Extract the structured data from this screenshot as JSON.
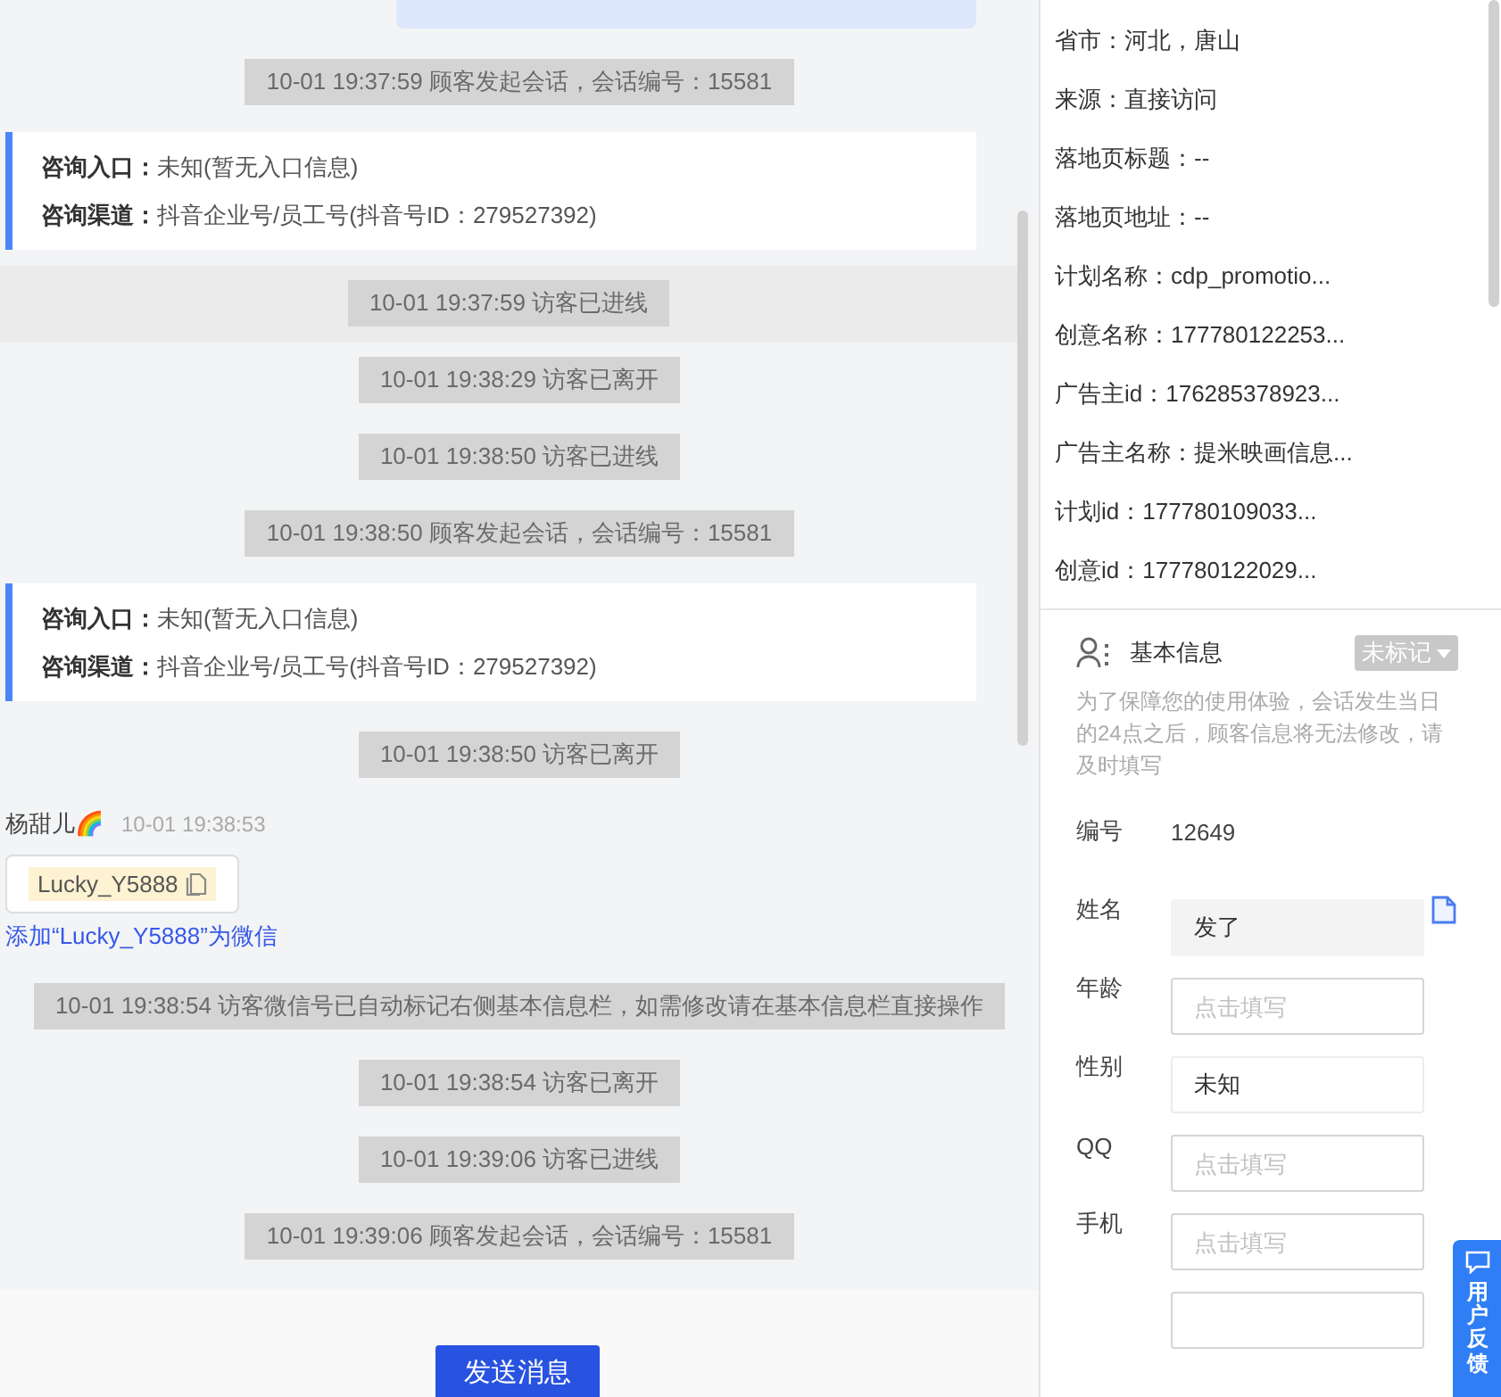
{
  "chat": {
    "events": [
      {
        "kind": "system",
        "text": "10-01 19:37:59 顾客发起会话，会话编号：15581",
        "highlighted": false
      },
      {
        "kind": "source",
        "rows": [
          {
            "label": "咨询入口：",
            "value": "未知(暂无入口信息)"
          },
          {
            "label": "咨询渠道：",
            "value": "抖音企业号/员工号(抖音号ID：279527392)"
          }
        ]
      },
      {
        "kind": "system",
        "text": "10-01 19:37:59 访客已进线",
        "highlighted": true
      },
      {
        "kind": "system",
        "text": "10-01 19:38:29 访客已离开",
        "highlighted": false
      },
      {
        "kind": "system",
        "text": "10-01 19:38:50 访客已进线",
        "highlighted": false
      },
      {
        "kind": "system",
        "text": "10-01 19:38:50 顾客发起会话，会话编号：15581",
        "highlighted": false
      },
      {
        "kind": "source",
        "rows": [
          {
            "label": "咨询入口：",
            "value": "未知(暂无入口信息)"
          },
          {
            "label": "咨询渠道：",
            "value": "抖音企业号/员工号(抖音号ID：279527392)"
          }
        ]
      },
      {
        "kind": "system",
        "text": "10-01 19:38:50 访客已离开",
        "highlighted": false
      },
      {
        "kind": "visitor",
        "name": "杨甜儿🌈",
        "time": "10-01 19:38:53",
        "wechat": "Lucky_Y5888",
        "link": "添加“Lucky_Y5888”为微信"
      },
      {
        "kind": "system",
        "text": "10-01 19:38:54 访客微信号已自动标记右侧基本信息栏，如需修改请在基本信息栏直接操作",
        "highlighted": false
      },
      {
        "kind": "system",
        "text": "10-01 19:38:54 访客已离开",
        "highlighted": false
      },
      {
        "kind": "system",
        "text": "10-01 19:39:06 访客已进线",
        "highlighted": false
      },
      {
        "kind": "system",
        "text": "10-01 19:39:06 顾客发起会话，会话编号：15581",
        "highlighted": false
      }
    ],
    "send_button": "发送消息"
  },
  "visit_info": [
    "省市：河北，唐山",
    "来源：直接访问",
    "落地页标题：--",
    "落地页地址：--",
    "计划名称：cdp_promotio...",
    "创意名称：177780122253...",
    "广告主id：176285378923...",
    "广告主名称：提米映画信息...",
    "计划id：177780109033...",
    "创意id：177780122029..."
  ],
  "basic_info": {
    "title": "基本信息",
    "tag": "未标记",
    "note": "为了保障您的使用体验，会话发生当日的24点之后，顾客信息将无法修改，请及时填写",
    "fields": [
      {
        "kind": "text",
        "label": "编号",
        "value": "12649"
      },
      {
        "kind": "input",
        "label": "姓名",
        "value": "发了",
        "disabled": true,
        "copy": true
      },
      {
        "kind": "input",
        "label": "年龄",
        "placeholder": "点击填写",
        "disabled": false,
        "copy": false
      },
      {
        "kind": "input",
        "label": "性别",
        "value": "未知",
        "disabled": false,
        "copy": false
      },
      {
        "kind": "input",
        "label": "QQ",
        "placeholder": "点击填写",
        "disabled": false,
        "copy": false
      },
      {
        "kind": "input",
        "label": "手机",
        "placeholder": "点击填写",
        "disabled": false,
        "copy": false
      }
    ]
  },
  "feedback_tab": "用户反馈"
}
